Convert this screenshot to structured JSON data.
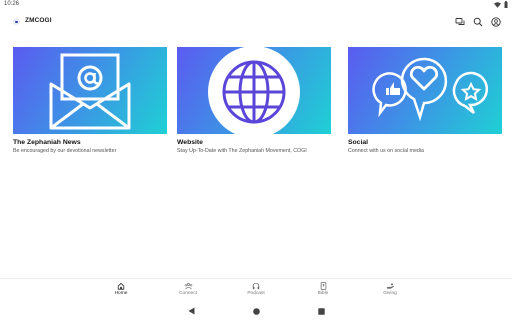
{
  "status_bar": {
    "time": "10:26"
  },
  "app_bar": {
    "title": "ZMCOGI",
    "actions": [
      {
        "icon": "messages-icon"
      },
      {
        "icon": "search-icon"
      },
      {
        "icon": "account-icon"
      }
    ]
  },
  "cards": [
    {
      "title": "The Zephaniah News",
      "subtitle": "Be encouraged by our devotional newsletter",
      "icon": "envelope-at-icon"
    },
    {
      "title": "Website",
      "subtitle": "Stay Up-To-Date with The Zephaniah Movement, COGI",
      "icon": "globe-icon"
    },
    {
      "title": "Social",
      "subtitle": "Connect with us on social media",
      "icon": "social-bubbles-icon"
    }
  ],
  "bottom_nav": {
    "items": [
      {
        "label": "Home",
        "icon": "home-icon",
        "active": true
      },
      {
        "label": "Connect",
        "icon": "connect-icon",
        "active": false
      },
      {
        "label": "Podcast",
        "icon": "headphones-icon",
        "active": false
      },
      {
        "label": "Bible",
        "icon": "bible-icon",
        "active": false
      },
      {
        "label": "Giving",
        "icon": "giving-icon",
        "active": false
      }
    ]
  },
  "colors": {
    "gradient_start": "#5b5bf0",
    "gradient_end": "#1fd0d4",
    "text": "#111111"
  }
}
